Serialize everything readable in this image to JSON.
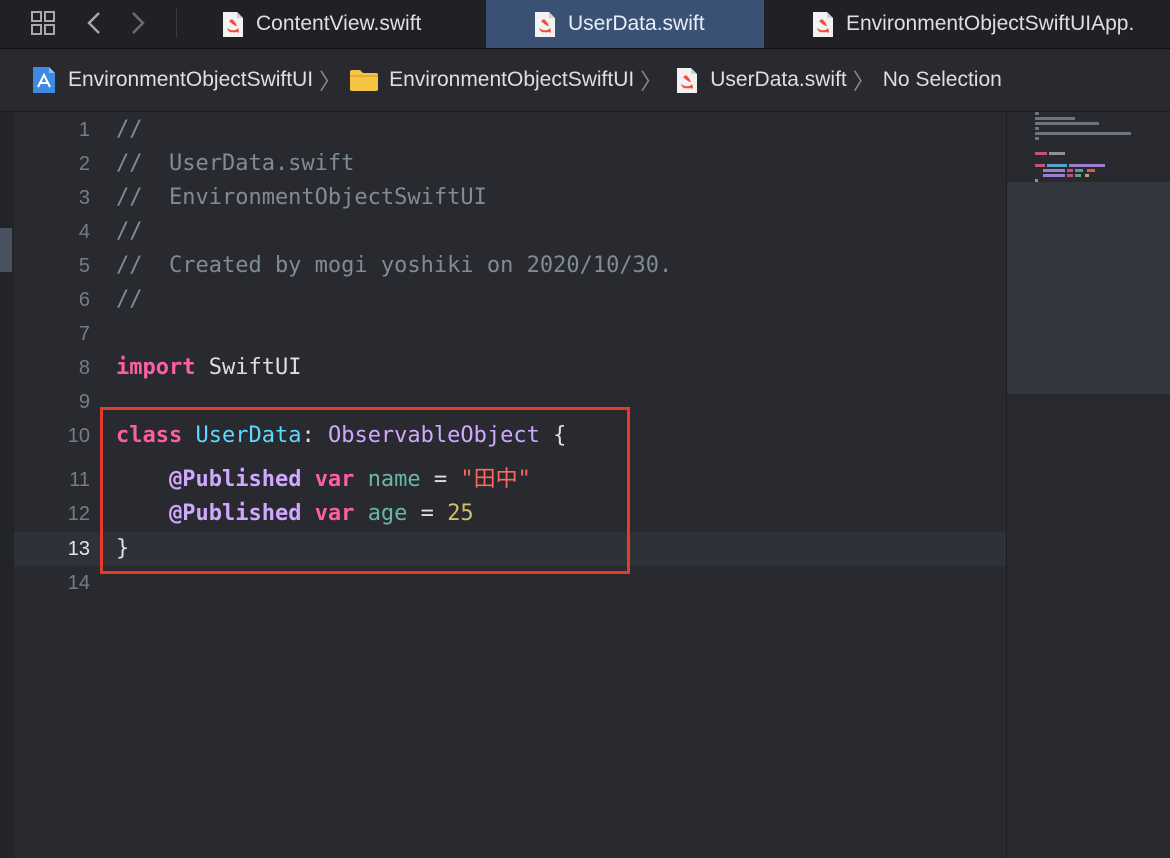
{
  "tabs": [
    {
      "label": "ContentView.swift",
      "active": false,
      "icon": "swift-file-icon"
    },
    {
      "label": "UserData.swift",
      "active": true,
      "icon": "swift-file-icon"
    },
    {
      "label": "EnvironmentObjectSwiftUIApp.",
      "active": false,
      "icon": "swift-file-icon"
    }
  ],
  "toolbar": {
    "grid_icon": "grid-icon",
    "back_icon": "chevron-left-icon",
    "forward_icon": "chevron-right-icon"
  },
  "jumpbar": {
    "project": "EnvironmentObjectSwiftUI",
    "folder": "EnvironmentObjectSwiftUI",
    "file": "UserData.swift",
    "selection": "No Selection"
  },
  "editor": {
    "current_line": 13,
    "lines": [
      {
        "n": "1",
        "tokens": [
          {
            "t": "//",
            "c": "cm"
          }
        ]
      },
      {
        "n": "2",
        "tokens": [
          {
            "t": "//  UserData.swift",
            "c": "cm"
          }
        ]
      },
      {
        "n": "3",
        "tokens": [
          {
            "t": "//  EnvironmentObjectSwiftUI",
            "c": "cm"
          }
        ]
      },
      {
        "n": "4",
        "tokens": [
          {
            "t": "//",
            "c": "cm"
          }
        ]
      },
      {
        "n": "5",
        "tokens": [
          {
            "t": "//  Created by mogi yoshiki on 2020/10/30.",
            "c": "cm"
          }
        ]
      },
      {
        "n": "6",
        "tokens": [
          {
            "t": "//",
            "c": "cm"
          }
        ]
      },
      {
        "n": "7",
        "tokens": []
      },
      {
        "n": "8",
        "tokens": [
          {
            "t": "import",
            "c": "kw"
          },
          {
            "t": " SwiftUI",
            "c": ""
          }
        ]
      },
      {
        "n": "9",
        "tokens": []
      },
      {
        "n": "10",
        "tokens": [
          {
            "t": "class",
            "c": "kw"
          },
          {
            "t": " ",
            "c": ""
          },
          {
            "t": "UserData",
            "c": "typ"
          },
          {
            "t": ": ",
            "c": ""
          },
          {
            "t": "ObservableObject",
            "c": "cls"
          },
          {
            "t": " {",
            "c": ""
          }
        ]
      },
      {
        "n": "11",
        "tokens": [
          {
            "t": "    ",
            "c": ""
          },
          {
            "t": "@Published",
            "c": "attr"
          },
          {
            "t": " ",
            "c": ""
          },
          {
            "t": "var",
            "c": "kw"
          },
          {
            "t": " ",
            "c": ""
          },
          {
            "t": "name",
            "c": "var"
          },
          {
            "t": " = ",
            "c": ""
          },
          {
            "t": "\"田中\"",
            "c": "str"
          }
        ]
      },
      {
        "n": "12",
        "tokens": [
          {
            "t": "    ",
            "c": ""
          },
          {
            "t": "@Published",
            "c": "attr"
          },
          {
            "t": " ",
            "c": ""
          },
          {
            "t": "var",
            "c": "kw"
          },
          {
            "t": " ",
            "c": ""
          },
          {
            "t": "age",
            "c": "var"
          },
          {
            "t": " = ",
            "c": ""
          },
          {
            "t": "25",
            "c": "num"
          }
        ]
      },
      {
        "n": "13",
        "tokens": [
          {
            "t": "}",
            "c": ""
          }
        ]
      },
      {
        "n": "14",
        "tokens": []
      }
    ]
  },
  "colors": {
    "highlight_border": "#e8392a",
    "active_tab": "#3a5173",
    "background": "#292a30"
  }
}
